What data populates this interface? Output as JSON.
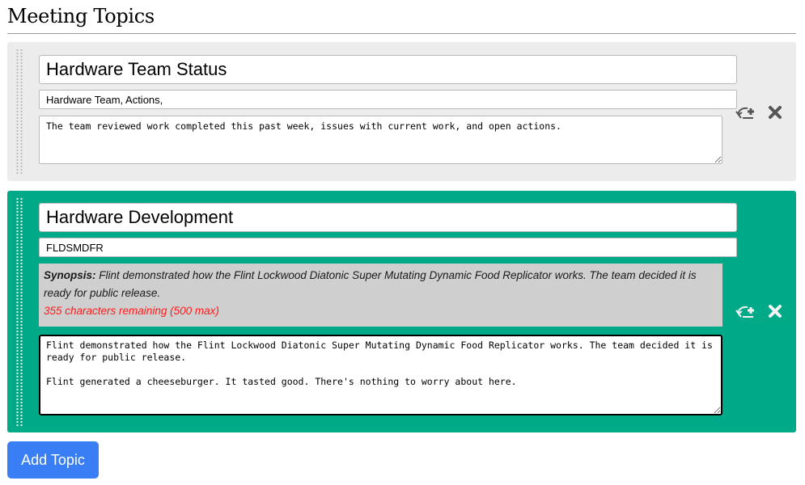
{
  "page": {
    "title": "Meeting Topics"
  },
  "topics": [
    {
      "title": "Hardware Team Status",
      "tags": "Hardware Team, Actions,",
      "notes": "The team reviewed work completed this past week, issues with current work, and open actions."
    },
    {
      "title": "Hardware Development",
      "tags": "FLDSMDFR",
      "synopsis": {
        "label": "Synopsis:",
        "text": "Flint demonstrated how the Flint Lockwood Diatonic Super Mutating Dynamic Food Replicator works. The team decided it is ready for public release.",
        "remaining": "355 characters remaining (500 max)"
      },
      "notes": "Flint demonstrated how the Flint Lockwood Diatonic Super Mutating Dynamic Food Replicator works. The team decided it is ready for public release.\n\nFlint generated a cheeseburger. It tasted good. There's nothing to worry about here."
    }
  ],
  "icons": {
    "drag_handle": "drag-handle-icon",
    "insert_topic": "insert-topic-icon",
    "delete_topic": "delete-icon"
  },
  "add_topic_label": "Add Topic",
  "colors": {
    "topic_default_bg": "#ececec",
    "topic_active_bg": "#00aa88",
    "synopsis_bg": "#cfcfcf",
    "remaining_text": "#ff1a1a",
    "button_bg": "#3a7ef5"
  }
}
